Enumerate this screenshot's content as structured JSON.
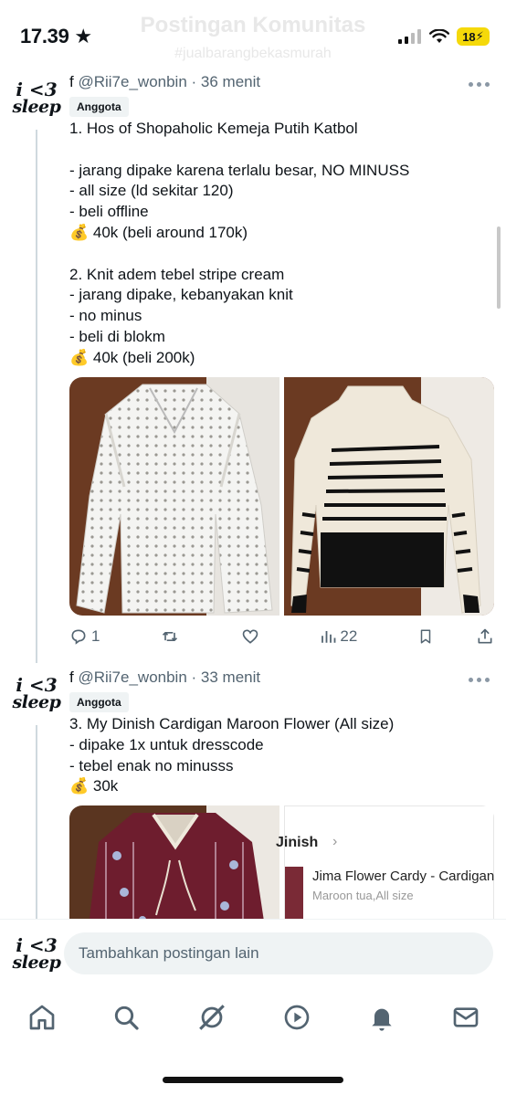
{
  "status": {
    "time": "17.39",
    "battery": "18"
  },
  "header": {
    "title": "Postingan Komunitas",
    "subtitle": "#jualbarangbekasmurah"
  },
  "posts": [
    {
      "display_name": "f",
      "handle": "@Rii7e_wonbin",
      "time": "· 36 menit",
      "badge": "Anggota",
      "text": "1. Hos of Shopaholic Kemeja Putih Katbol\n\n- jarang dipake karena terlalu besar, NO MINUSS\n- all size (ld sekitar 120)\n- beli offline\n💰 40k (beli around 170k)\n\n2. Knit adem tebel stripe cream\n- jarang dipake, kebanyakan knit\n- no minus\n- beli di blokm\n💰 40k (beli 200k)",
      "replies": "1",
      "retweets": "",
      "likes": "",
      "views": "22"
    },
    {
      "display_name": "f",
      "handle": "@Rii7e_wonbin",
      "time": "· 33 menit",
      "badge": "Anggota",
      "text": "3. My Dinish Cardigan Maroon Flower (All size)\n- dipake 1x untuk dresscode\n- tebel enak no minusss\n💰 30k",
      "screenshot": {
        "store": "Jinish",
        "product": "Jima Flower Cardy - Cardigan",
        "variant": "Maroon tua,All size"
      }
    }
  ],
  "avatar": {
    "line1": "i <3",
    "line2": "sleep"
  },
  "reply": {
    "placeholder": "Tambahkan postingan lain"
  },
  "colors": {
    "accent": "#1d9bf0",
    "muted": "#536471",
    "text": "#0f1419"
  }
}
